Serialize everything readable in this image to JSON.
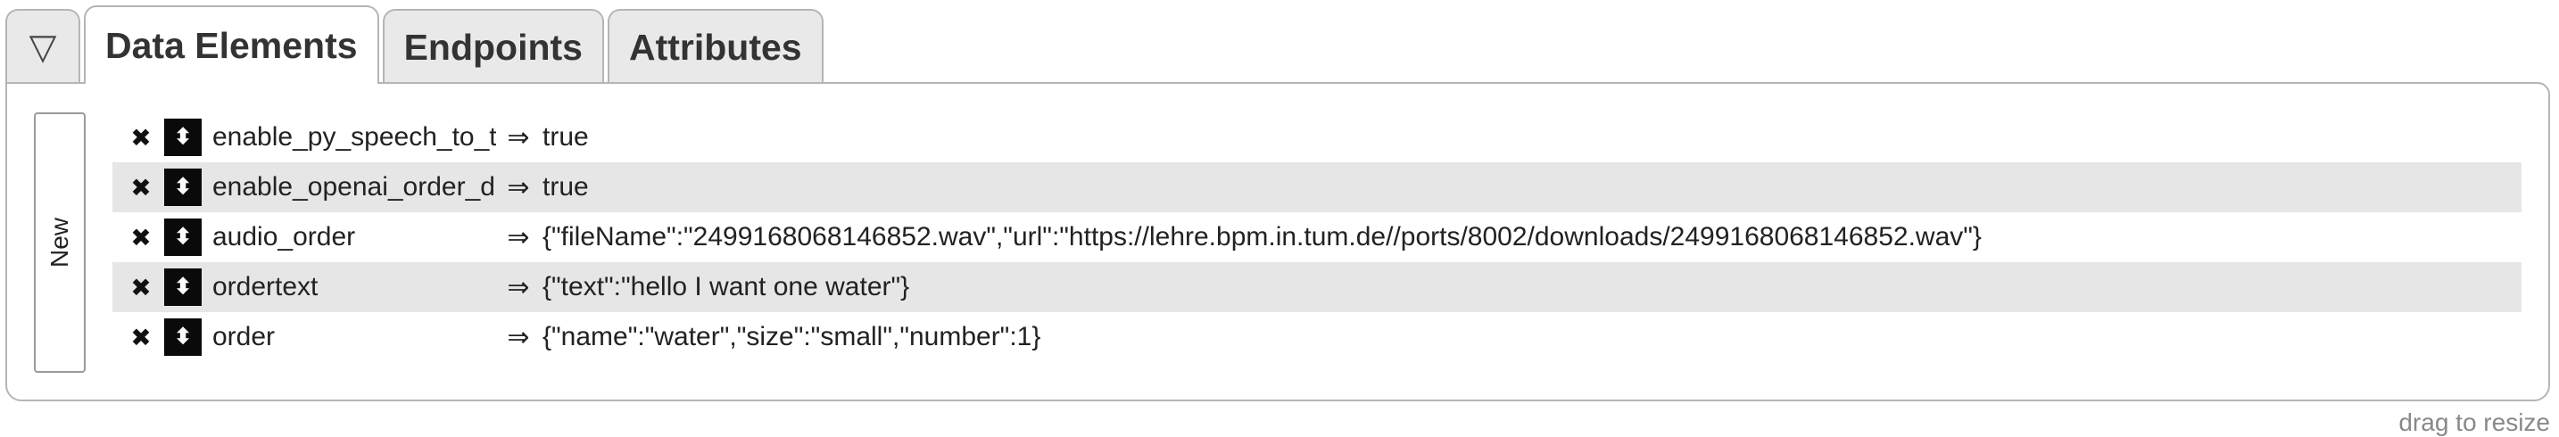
{
  "tabs": {
    "toggle_icon": "▽",
    "items": [
      {
        "label": "Data Elements",
        "active": true
      },
      {
        "label": "Endpoints",
        "active": false
      },
      {
        "label": "Attributes",
        "active": false
      }
    ]
  },
  "panel": {
    "new_label": "New",
    "delete_icon": "✖",
    "drag_icon": "⬍",
    "arrow": "⇒",
    "rows": [
      {
        "name": "enable_py_speech_to_text",
        "value": "true"
      },
      {
        "name": "enable_openai_order_detection",
        "value": "true"
      },
      {
        "name": "audio_order",
        "value": "{\"fileName\":\"2499168068146852.wav\",\"url\":\"https://lehre.bpm.in.tum.de//ports/8002/downloads/2499168068146852.wav\"}"
      },
      {
        "name": "ordertext",
        "value": "{\"text\":\"hello I want one water\"}"
      },
      {
        "name": "order",
        "value": "{\"name\":\"water\",\"size\":\"small\",\"number\":1}"
      }
    ]
  },
  "footer": {
    "resize_label": "drag to resize"
  }
}
